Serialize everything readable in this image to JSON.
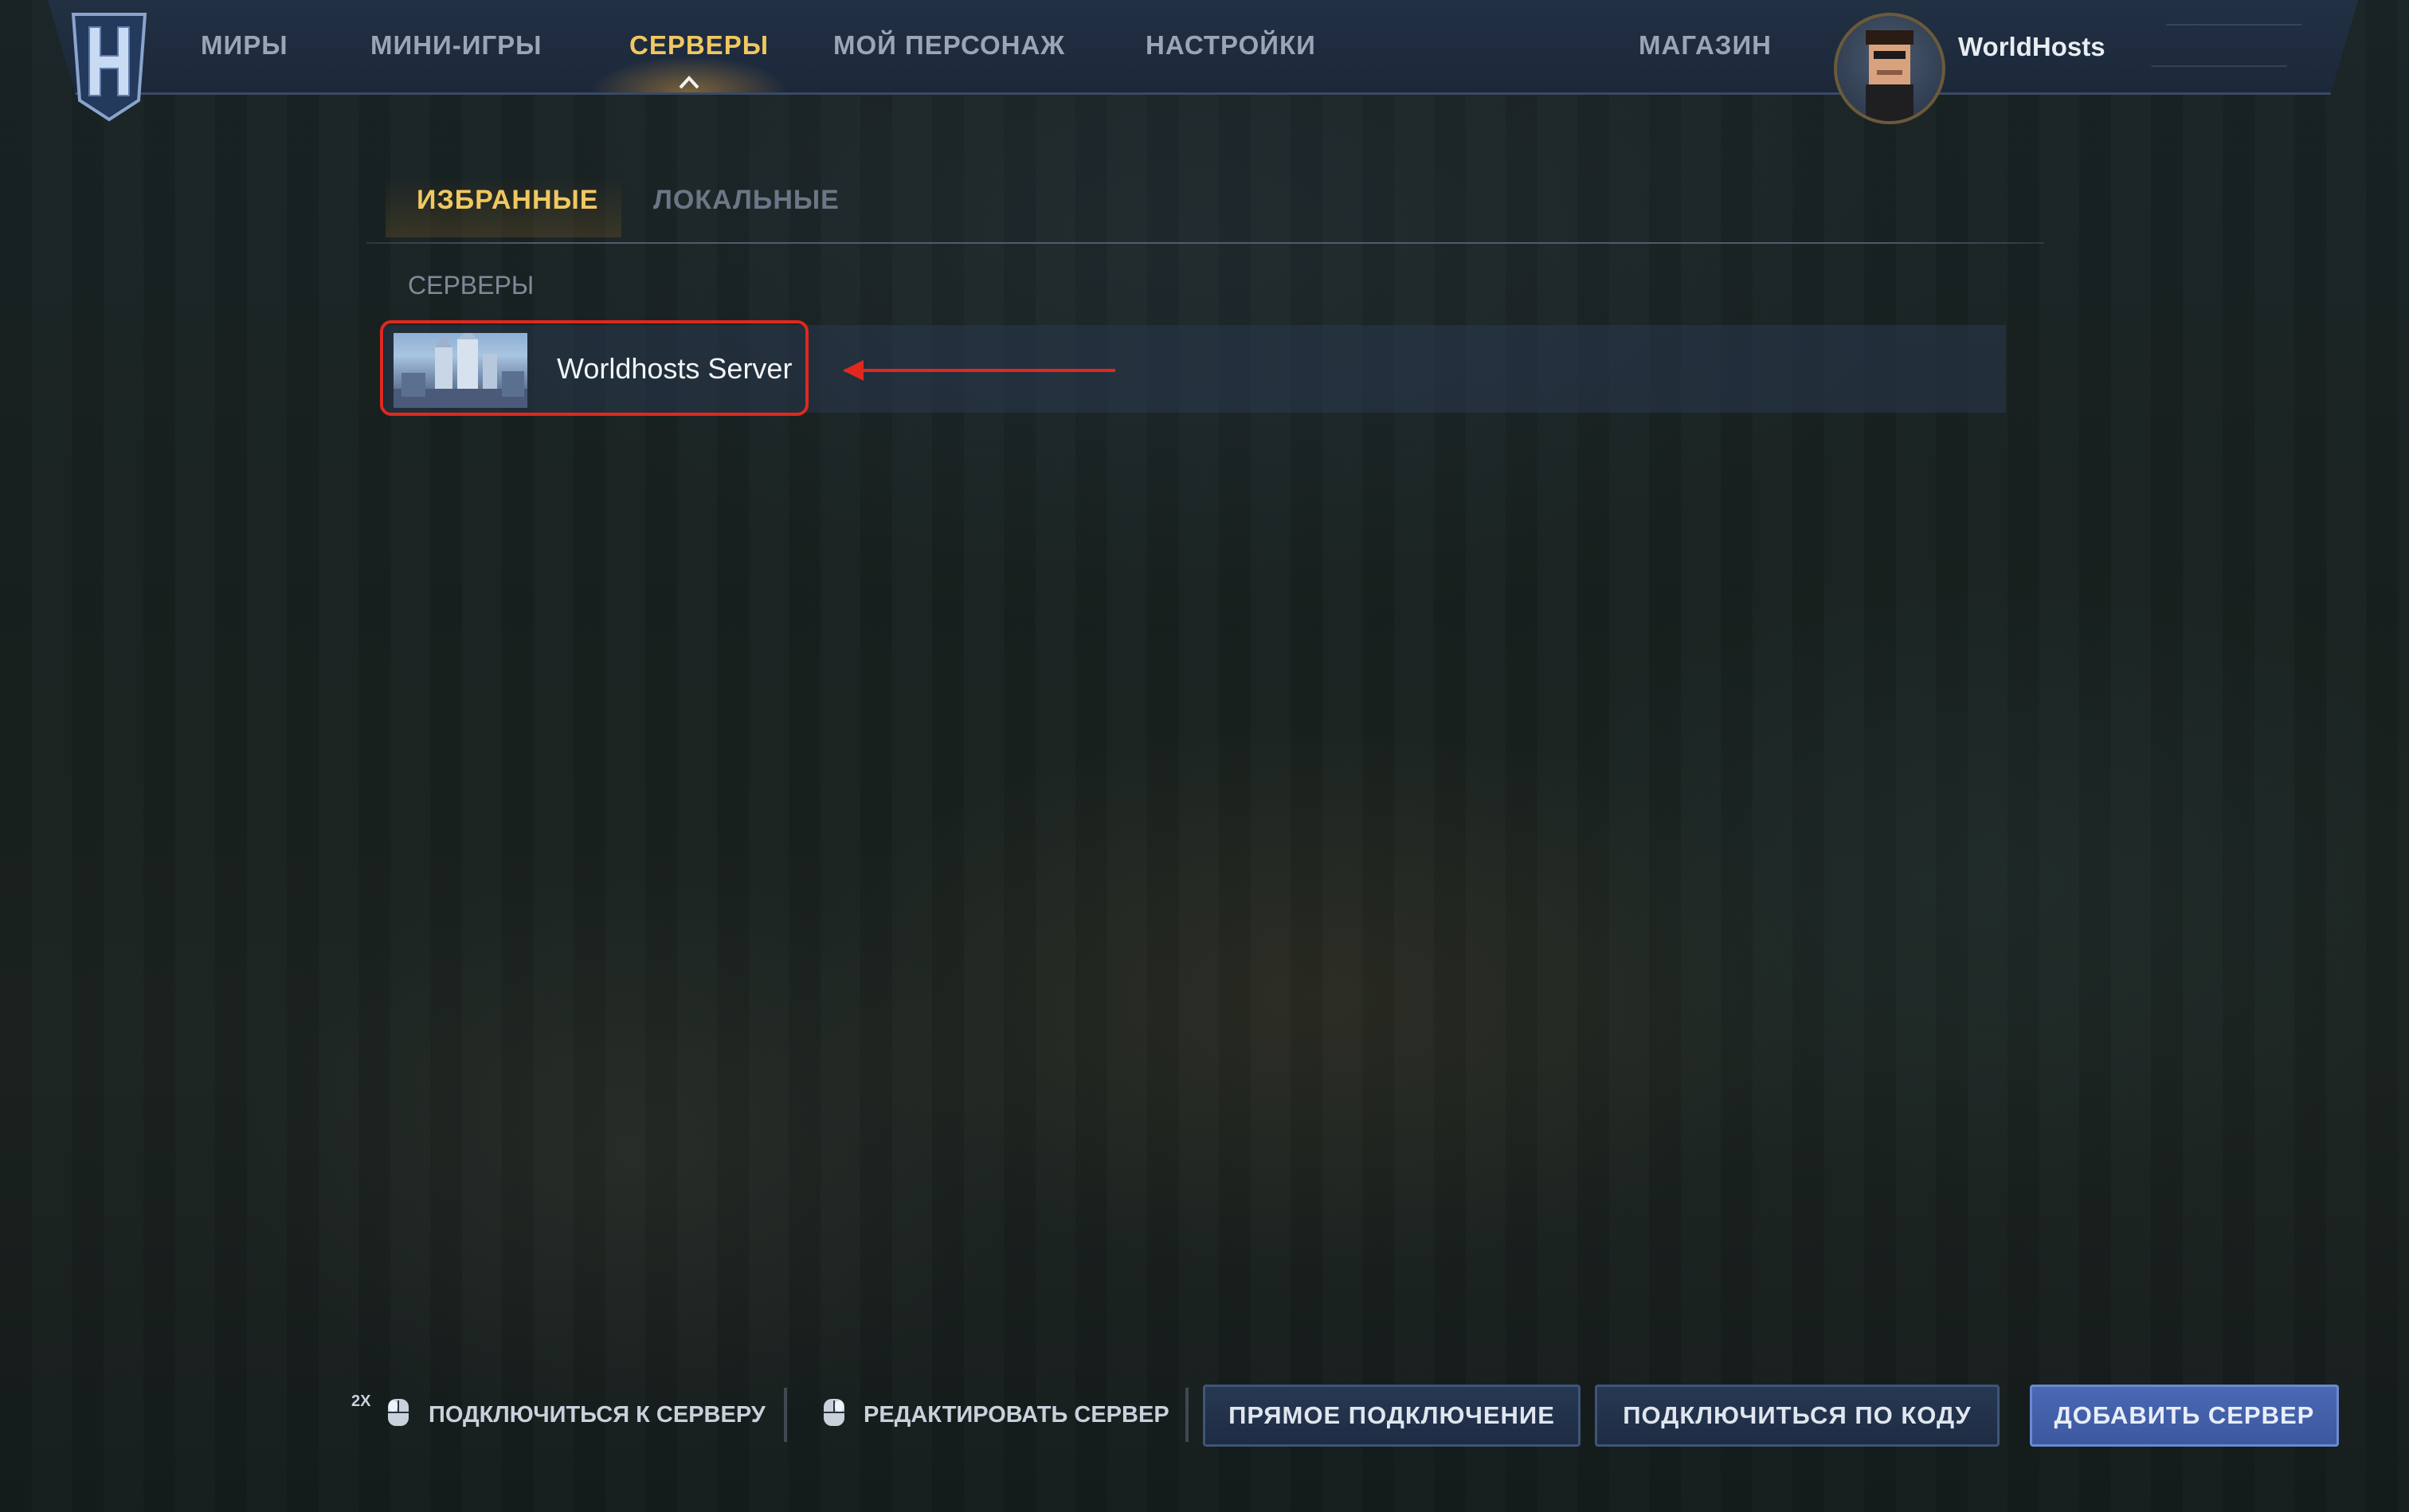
{
  "nav": {
    "items": [
      {
        "label": "МИРЫ"
      },
      {
        "label": "МИНИ-ИГРЫ"
      },
      {
        "label": "СЕРВЕРЫ",
        "active": true
      },
      {
        "label": "МОЙ ПЕРСОНАЖ"
      },
      {
        "label": "НАСТРОЙКИ"
      }
    ],
    "shop_label": "МАГАЗИН",
    "username": "WorldHosts"
  },
  "tabs": {
    "favorites": "ИЗБРАННЫЕ",
    "local": "ЛОКАЛЬНЫЕ"
  },
  "servers": {
    "section_label": "СЕРВЕРЫ",
    "list": [
      {
        "name": "Worldhosts Server"
      }
    ]
  },
  "actions": {
    "connect_modifier": "2X",
    "connect_label": "ПОДКЛЮЧИТЬСЯ К СЕРВЕРУ",
    "edit_label": "РЕДАКТИРОВАТЬ СЕРВЕР",
    "direct_connect": "ПРЯМОЕ ПОДКЛЮЧЕНИЕ",
    "connect_by_code": "ПОДКЛЮЧИТЬСЯ ПО КОДУ",
    "add_server": "ДОБАВИТЬ СЕРВЕР"
  },
  "colors": {
    "accent_gold": "#f0c860",
    "highlight_red": "#e0281e",
    "primary_button": "#4a68b4",
    "navbar": "#1f2b3e"
  }
}
